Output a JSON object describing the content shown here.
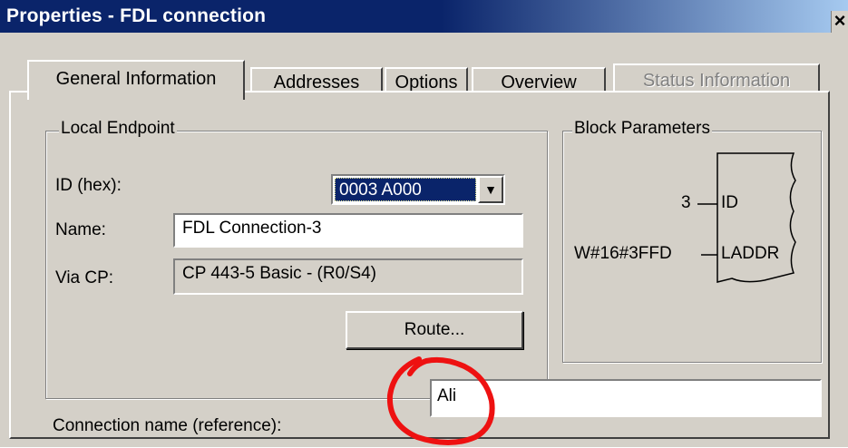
{
  "window": {
    "title": "Properties - FDL connection",
    "close_glyph": "×"
  },
  "tabs": [
    {
      "label": "General Information",
      "state": "active"
    },
    {
      "label": "Addresses",
      "state": "normal"
    },
    {
      "label": "Options",
      "state": "normal"
    },
    {
      "label": "Overview",
      "state": "normal"
    },
    {
      "label": "Status Information",
      "state": "disabled"
    }
  ],
  "local_endpoint": {
    "group_label": "Local Endpoint",
    "id_label": "ID (hex):",
    "id_value": "0003 A000",
    "name_label": "Name:",
    "name_value": "FDL Connection-3",
    "via_cp_label": "Via CP:",
    "via_cp_value": "CP 443-5 Basic - (R0/S4)",
    "route_button": "Route...",
    "dropdown_icon": "chevron-down-icon"
  },
  "block_parameters": {
    "group_label": "Block Parameters",
    "id_input": "3",
    "id_param": "ID",
    "laddr_input": "W#16#3FFD",
    "laddr_param": "LADDR"
  },
  "connection_name": {
    "label": "Connection name (reference):",
    "value": "Ali"
  },
  "colors": {
    "titlebar": "#0a246a",
    "dialog_bg": "#d4d0c8",
    "selection": "#0a246a",
    "annotation": "#ee1111"
  }
}
